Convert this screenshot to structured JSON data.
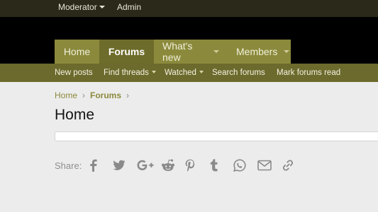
{
  "topbar": {
    "moderator_label": "Moderator",
    "admin_label": "Admin"
  },
  "nav": {
    "tabs": [
      {
        "label": "Home"
      },
      {
        "label": "Forums"
      },
      {
        "label": "What's new"
      },
      {
        "label": "Members"
      }
    ]
  },
  "subnav": {
    "items": [
      {
        "label": "New posts"
      },
      {
        "label": "Find threads"
      },
      {
        "label": "Watched"
      },
      {
        "label": "Search forums"
      },
      {
        "label": "Mark forums read"
      }
    ]
  },
  "breadcrumb": {
    "items": [
      {
        "label": "Home"
      },
      {
        "label": "Forums"
      }
    ],
    "separator": "›"
  },
  "page": {
    "title": "Home"
  },
  "share": {
    "label": "Share:",
    "icons": [
      "facebook-icon",
      "twitter-icon",
      "google-plus-icon",
      "reddit-icon",
      "pinterest-icon",
      "tumblr-icon",
      "whatsapp-icon",
      "email-icon",
      "link-icon"
    ]
  },
  "colors": {
    "topbar": "#2b2a1a",
    "tab": "#8b8a3c",
    "tab_active": "#6e6c2a",
    "subnav": "#6c6a2c",
    "link": "#8b8a3c"
  }
}
